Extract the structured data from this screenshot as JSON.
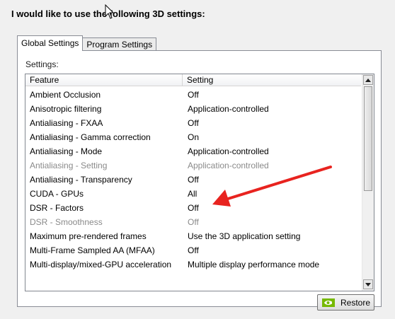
{
  "heading": "I would like to use the following 3D settings:",
  "tabs": [
    {
      "label": "Global Settings",
      "active": true
    },
    {
      "label": "Program Settings",
      "active": false
    }
  ],
  "settings_label": "Settings:",
  "columns": {
    "feature": "Feature",
    "setting": "Setting"
  },
  "rows": [
    {
      "feature": "Ambient Occlusion",
      "setting": "Off",
      "disabled": false
    },
    {
      "feature": "Anisotropic filtering",
      "setting": "Application-controlled",
      "disabled": false
    },
    {
      "feature": "Antialiasing - FXAA",
      "setting": "Off",
      "disabled": false
    },
    {
      "feature": "Antialiasing - Gamma correction",
      "setting": "On",
      "disabled": false
    },
    {
      "feature": "Antialiasing - Mode",
      "setting": "Application-controlled",
      "disabled": false
    },
    {
      "feature": "Antialiasing - Setting",
      "setting": "Application-controlled",
      "disabled": true
    },
    {
      "feature": "Antialiasing - Transparency",
      "setting": "Off",
      "disabled": false
    },
    {
      "feature": "CUDA - GPUs",
      "setting": "All",
      "disabled": false
    },
    {
      "feature": "DSR - Factors",
      "setting": "Off",
      "disabled": false
    },
    {
      "feature": "DSR - Smoothness",
      "setting": "Off",
      "disabled": true
    },
    {
      "feature": "Maximum pre-rendered frames",
      "setting": "Use the 3D application setting",
      "disabled": false
    },
    {
      "feature": "Multi-Frame Sampled AA (MFAA)",
      "setting": "Off",
      "disabled": false
    },
    {
      "feature": "Multi-display/mixed-GPU acceleration",
      "setting": "Multiple display performance mode",
      "disabled": false
    }
  ],
  "restore_label": "Restore",
  "icons": {
    "restore": "nvidia-logo-icon",
    "scroll_up": "triangle-up-icon",
    "scroll_down": "triangle-down-icon",
    "cursor": "mouse-pointer-icon",
    "annotation": "red-arrow-icon"
  },
  "colors": {
    "annotation_arrow": "#e8231f",
    "nvidia_green": "#76b900",
    "disabled_text": "#8a8a8a"
  }
}
